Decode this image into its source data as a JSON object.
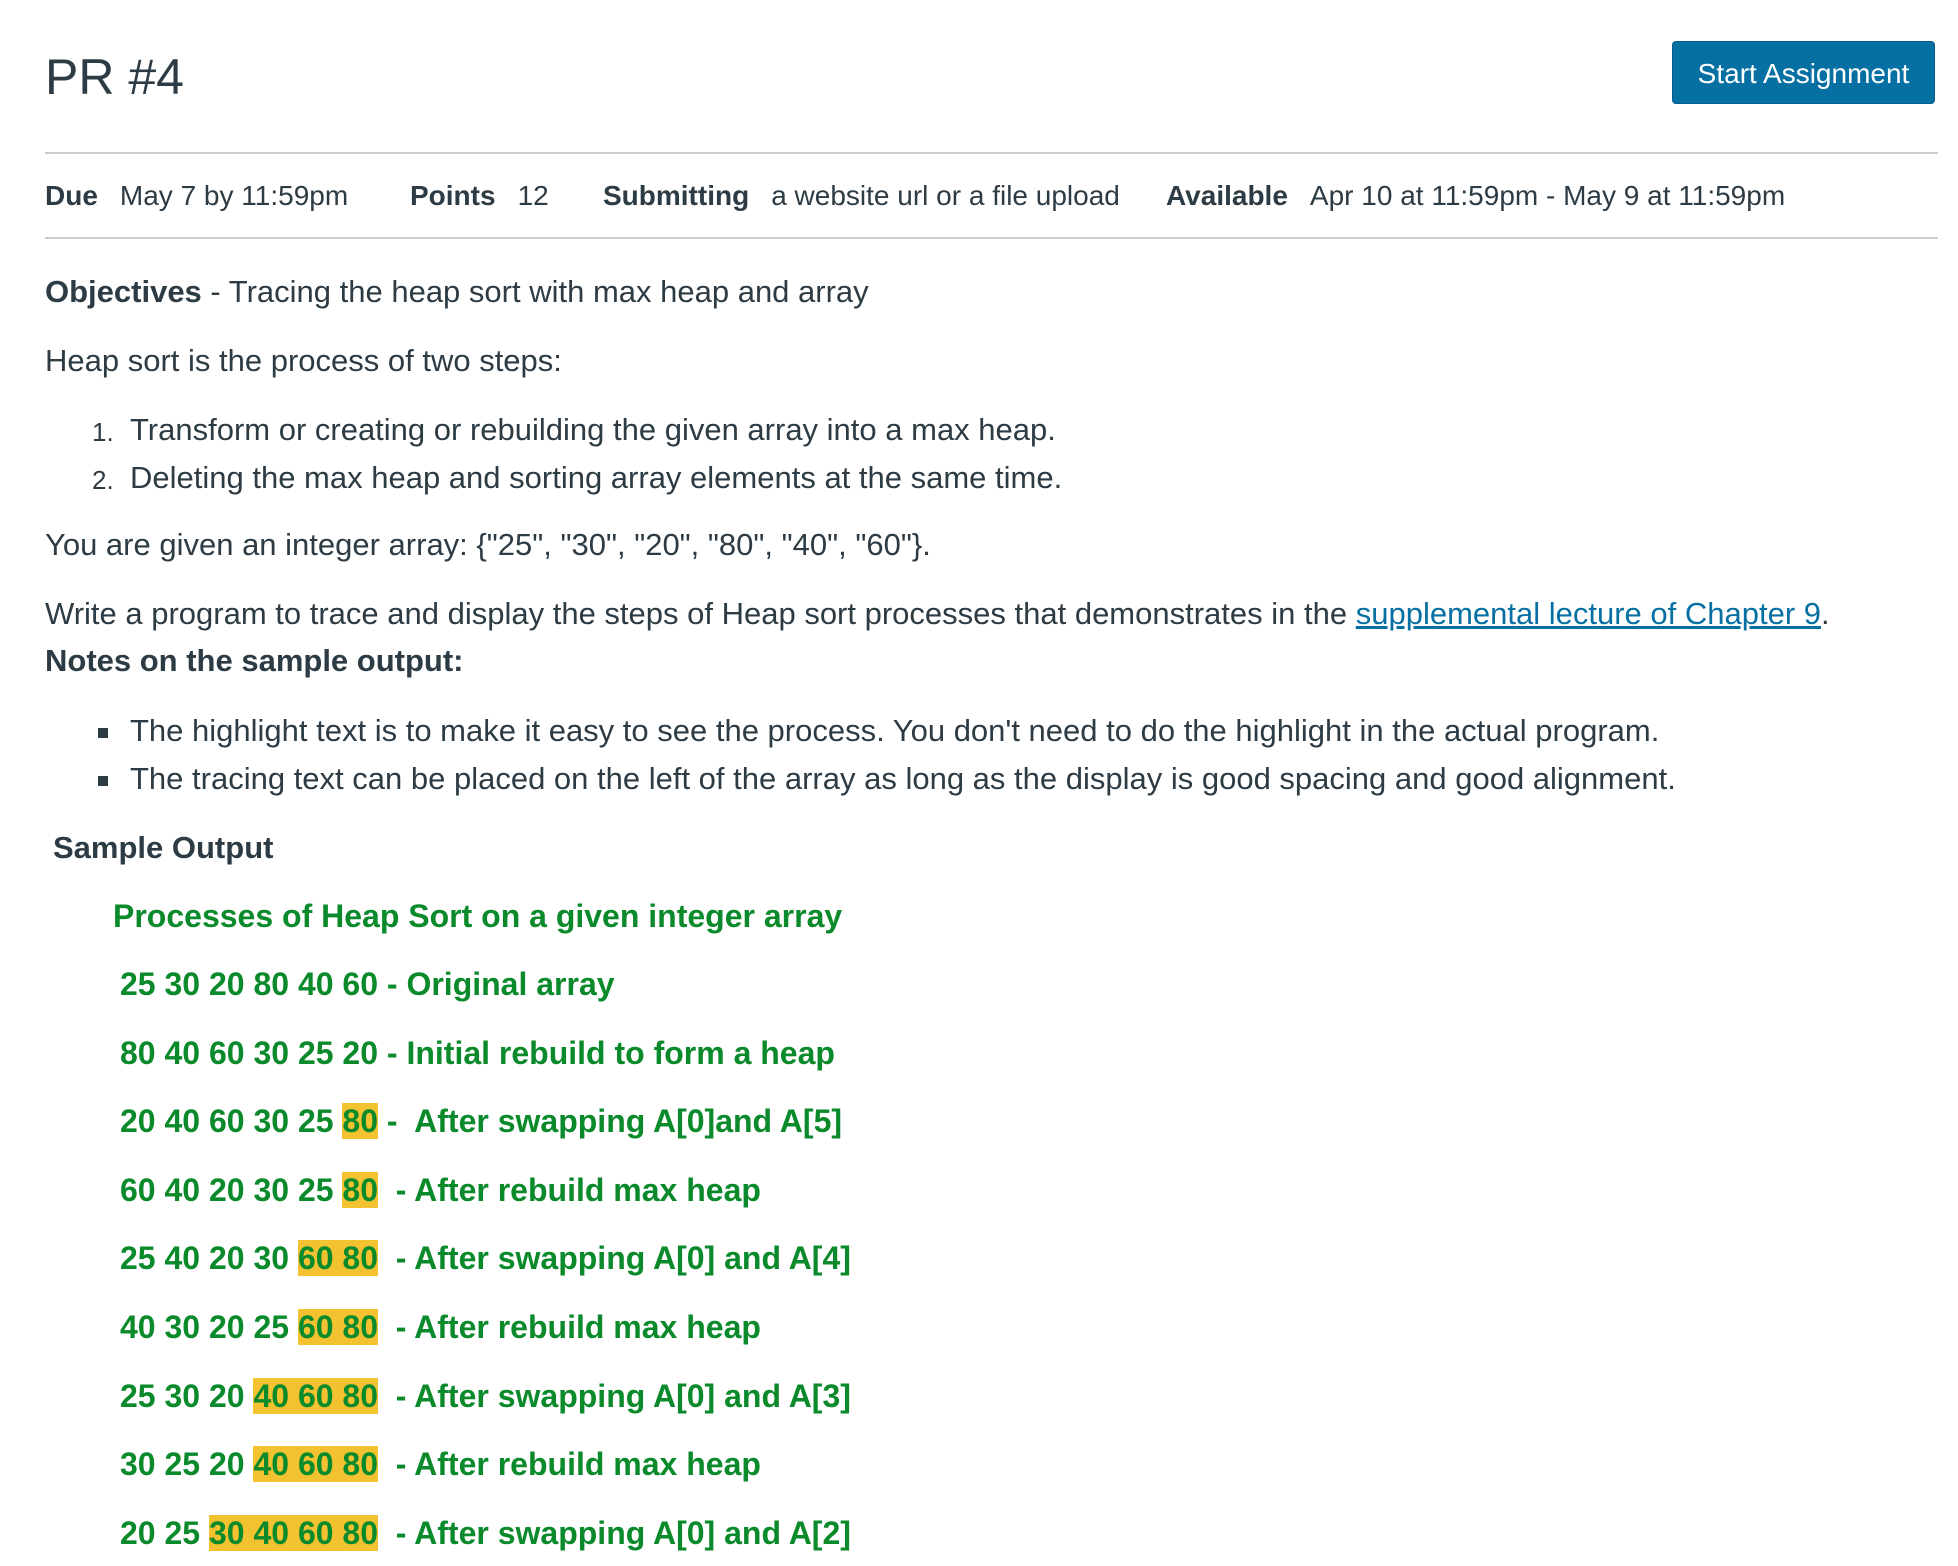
{
  "header": {
    "title": "PR #4",
    "start_button": "Start Assignment"
  },
  "details": {
    "due_label": "Due",
    "due_value": "May 7 by 11:59pm",
    "points_label": "Points",
    "points_value": "12",
    "submitting_label": "Submitting",
    "submitting_value": "a website url or a file upload",
    "available_label": "Available",
    "available_value": "Apr 10 at 11:59pm - May 9 at 11:59pm"
  },
  "content": {
    "objectives_label": "Objectives",
    "objectives_text": " - Tracing the heap sort with max heap and array",
    "intro": "Heap sort is the process of two steps:",
    "steps": [
      {
        "num": "1.",
        "text": "Transform or creating or rebuilding the given array into a max heap."
      },
      {
        "num": "2.",
        "text": "Deleting the max heap and sorting array elements at the same time."
      }
    ],
    "given_array": "You are given an integer array: {\"25\", \"30\", \"20\", \"80\", \"40\", \"60\"}.",
    "write_program": "Write a program to trace and display the steps of Heap sort processes that demonstrates in the ",
    "link_text": "supplemental lecture of Chapter 9",
    "write_program_end": ".",
    "notes_heading": "Notes on the sample output:",
    "notes": [
      "The highlight text is to make it easy to see the process.  You don't need to do the highlight in the actual program.",
      "The tracing text can be placed on the left of the array as long as the display is good spacing and good alignment."
    ],
    "sample_output_heading": "Sample Output"
  },
  "sample_output": {
    "heading": "Processes of Heap Sort on a given integer array",
    "rows": [
      {
        "plain": "25 30 20 80 40 60",
        "highlight": "",
        "desc": " - Original array"
      },
      {
        "plain": "80 40 60 30 25 20",
        "highlight": "",
        "desc": " - Initial rebuild to form a heap"
      },
      {
        "plain": "20 40 60 30 25 ",
        "highlight": "80",
        "desc": " -  After swapping A[0]and A[5]"
      },
      {
        "plain": "60 40 20 30 25 ",
        "highlight": "80",
        "desc": "  - After rebuild max heap"
      },
      {
        "plain": "25 40 20 30 ",
        "highlight": "60 80",
        "desc": "  - After swapping A[0] and A[4]"
      },
      {
        "plain": "40 30 20 25 ",
        "highlight": "60 80",
        "desc": "  - After rebuild max heap"
      },
      {
        "plain": "25 30 20 ",
        "highlight": "40 60 80",
        "desc": "  - After swapping A[0] and A[3]"
      },
      {
        "plain": "30 25 20 ",
        "highlight": "40 60 80",
        "desc": "  - After rebuild max heap"
      },
      {
        "plain": "20 25 ",
        "highlight": "30 40 60 80",
        "desc": "  - After swapping A[0] and A[2]"
      }
    ]
  },
  "colors": {
    "text": "#2d3b45",
    "button": "#0770a3",
    "link": "#0770a3",
    "green": "#0a8a2a",
    "highlight": "#f2c230"
  }
}
